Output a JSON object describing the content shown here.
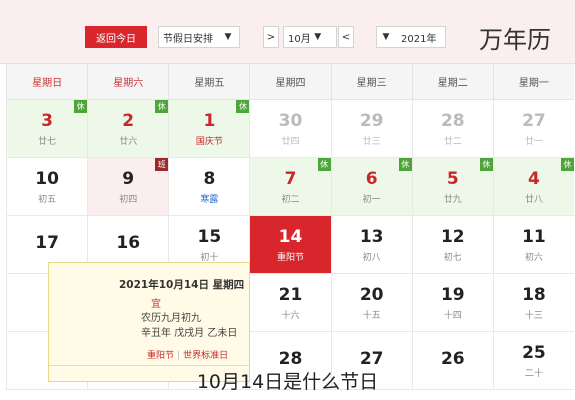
{
  "header": {
    "title": "万年历",
    "year_value": "2021年",
    "month_prev": "<",
    "month_value": "10月",
    "month_next": ">",
    "holiday_select": "节假日安排",
    "today_button": "返回今日"
  },
  "weekdays": [
    "星期一",
    "星期二",
    "星期三",
    "星期四",
    "星期五",
    "星期六",
    "星期日"
  ],
  "weeks": [
    [
      {
        "day": "27",
        "sub": "廿一",
        "type": "other"
      },
      {
        "day": "28",
        "sub": "廿二",
        "type": "other"
      },
      {
        "day": "29",
        "sub": "廿三",
        "type": "other"
      },
      {
        "day": "30",
        "sub": "廿四",
        "type": "other"
      },
      {
        "day": "1",
        "sub": "国庆节",
        "type": "holiday",
        "badge": "休"
      },
      {
        "day": "2",
        "sub": "廿六",
        "type": "holiday",
        "badge": "休"
      },
      {
        "day": "3",
        "sub": "廿七",
        "type": "holiday",
        "badge": "休"
      }
    ],
    [
      {
        "day": "4",
        "sub": "廿八",
        "type": "holiday",
        "badge": "休"
      },
      {
        "day": "5",
        "sub": "廿九",
        "type": "holiday",
        "badge": "休"
      },
      {
        "day": "6",
        "sub": "初一",
        "type": "holiday",
        "badge": "休"
      },
      {
        "day": "7",
        "sub": "初二",
        "type": "holiday",
        "badge": "休"
      },
      {
        "day": "8",
        "sub": "寒露",
        "type": "normal"
      },
      {
        "day": "9",
        "sub": "初四",
        "type": "workday",
        "badge": "班"
      },
      {
        "day": "10",
        "sub": "初五",
        "type": "normal"
      }
    ],
    [
      {
        "day": "11",
        "sub": "初六",
        "type": "normal"
      },
      {
        "day": "12",
        "sub": "初七",
        "type": "normal"
      },
      {
        "day": "13",
        "sub": "初八",
        "type": "normal"
      },
      {
        "day": "14",
        "sub": "重阳节",
        "type": "today"
      },
      {
        "day": "15",
        "sub": "初十",
        "type": "normal"
      },
      {
        "day": "16",
        "sub": "",
        "type": "normal"
      },
      {
        "day": "17",
        "sub": "",
        "type": "normal"
      }
    ],
    [
      {
        "day": "18",
        "sub": "十三",
        "type": "normal"
      },
      {
        "day": "19",
        "sub": "十四",
        "type": "normal"
      },
      {
        "day": "20",
        "sub": "十五",
        "type": "normal"
      },
      {
        "day": "21",
        "sub": "十六",
        "type": "normal"
      },
      {
        "day": "",
        "sub": "",
        "type": "normal"
      },
      {
        "day": "",
        "sub": "",
        "type": "normal"
      },
      {
        "day": "",
        "sub": "",
        "type": "normal"
      }
    ],
    [
      {
        "day": "25",
        "sub": "二十",
        "type": "normal"
      },
      {
        "day": "26",
        "sub": "",
        "type": "normal"
      },
      {
        "day": "27",
        "sub": "",
        "type": "normal"
      },
      {
        "day": "28",
        "sub": "",
        "type": "normal"
      },
      {
        "day": "",
        "sub": "",
        "type": "normal"
      },
      {
        "day": "",
        "sub": "",
        "type": "normal"
      },
      {
        "day": "",
        "sub": "",
        "type": "normal"
      }
    ]
  ],
  "popup": {
    "date_line": "2021年10月14日 星期四",
    "yi_label": "宜",
    "lunar_line": "农历九月初九",
    "ganzhi_year": "辛丑年",
    "ganzhi_month": "戊戌月",
    "ganzhi_day": "乙未日",
    "festival_tag": "重阳节",
    "world_day_tag": "世界标准日"
  },
  "caption": "10月14日是什么节日",
  "colors": {
    "accent_red": "#d8262c",
    "holiday_green": "#eef8e8",
    "workday_pink": "#fbeeee",
    "rest_badge": "#4ea63a"
  }
}
